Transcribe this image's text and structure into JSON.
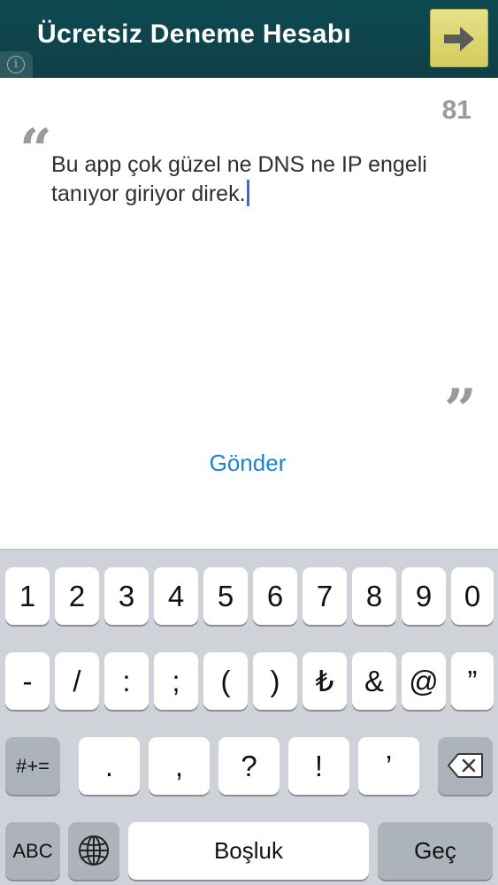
{
  "header": {
    "title": "Ücretsiz Deneme Hesabı",
    "info_glyph": "i"
  },
  "compose": {
    "char_counter": "81",
    "open_quote": "“",
    "close_quote": "”",
    "message_text": "Bu app çok güzel ne DNS ne IP engeli tanıyor giriyor direk.",
    "send_label": "Gönder"
  },
  "keyboard": {
    "row1": [
      "1",
      "2",
      "3",
      "4",
      "5",
      "6",
      "7",
      "8",
      "9",
      "0"
    ],
    "row2": [
      "-",
      "/",
      ":",
      ";",
      "(",
      ")",
      "₺",
      "&",
      "@",
      "”"
    ],
    "row3": [
      ".",
      ",",
      "?",
      "!",
      "’"
    ],
    "symbols_toggle_label": "#+=",
    "abc_label": "ABC",
    "space_label": "Boşluk",
    "return_label": "Geç"
  },
  "icons": [
    "info-icon",
    "arrow-right-icon",
    "globe-icon",
    "backspace-icon"
  ],
  "colors": {
    "header_bg": "#0e4a52",
    "next_button_bg": "#e0d977",
    "send_link": "#1a82d8",
    "keyboard_bg": "#cfd3d9"
  }
}
